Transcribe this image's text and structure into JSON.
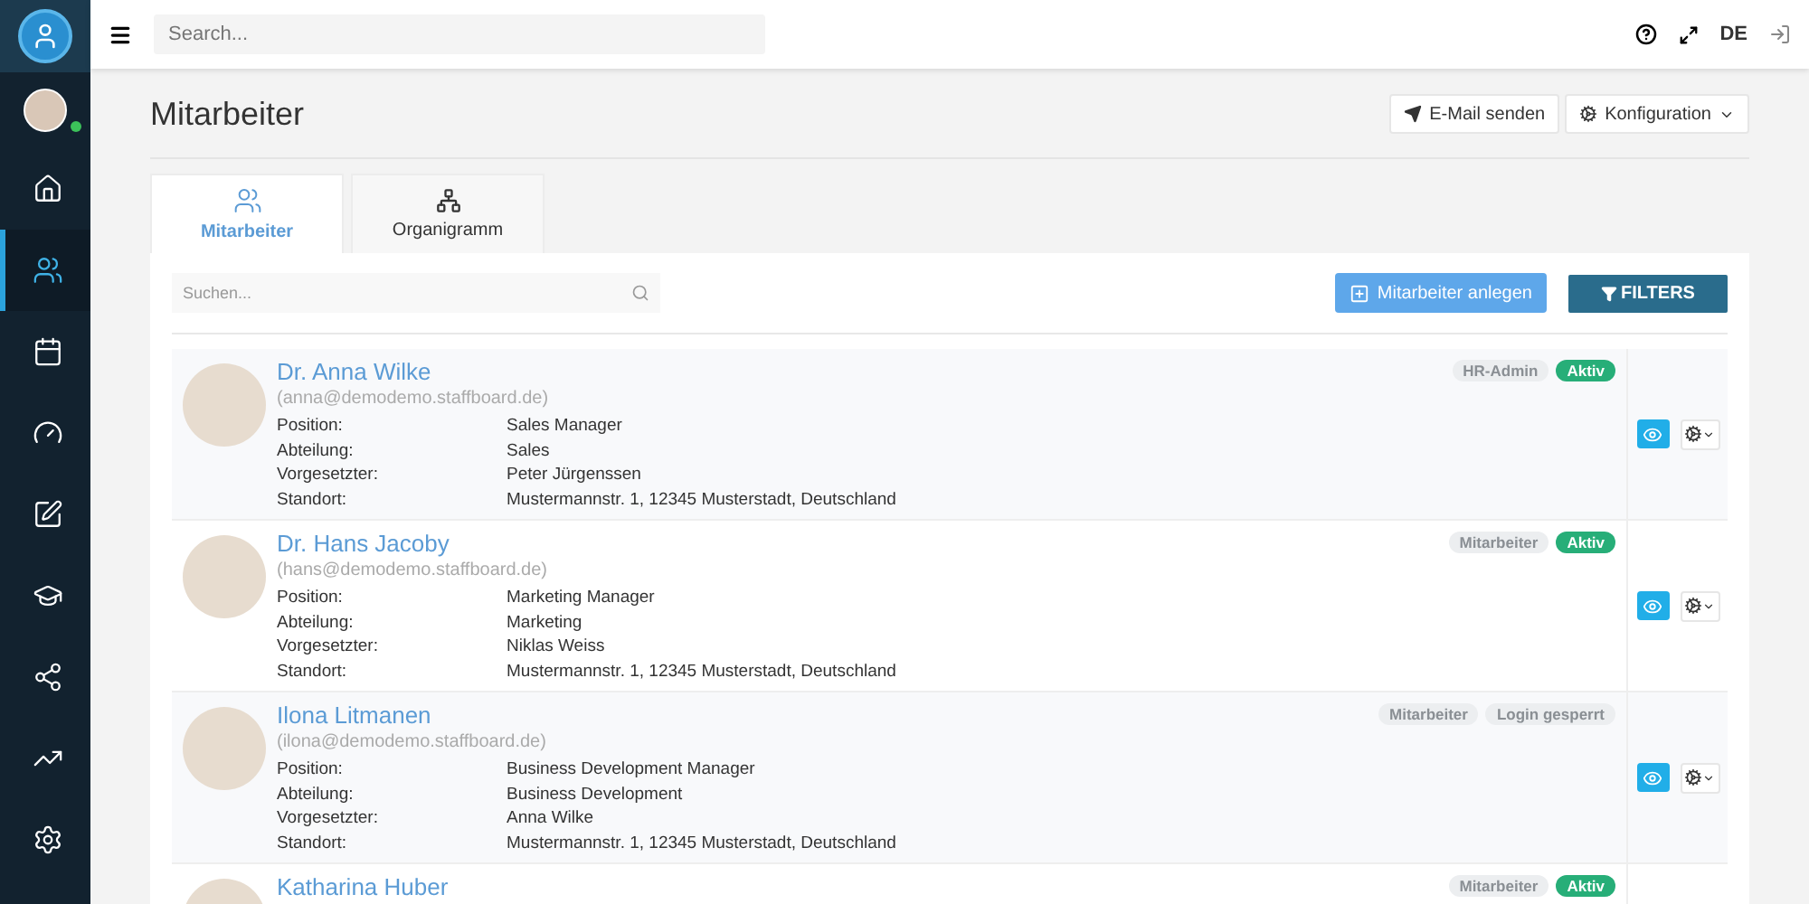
{
  "topbar": {
    "search_placeholder": "Search...",
    "language": "DE"
  },
  "sidebar": {
    "items": [
      {
        "kind": "home",
        "selected": false
      },
      {
        "kind": "users",
        "selected": true
      },
      {
        "kind": "calendar",
        "selected": false
      },
      {
        "kind": "gauge",
        "selected": false
      },
      {
        "kind": "edit",
        "selected": false
      },
      {
        "kind": "education",
        "selected": false
      },
      {
        "kind": "share",
        "selected": false
      },
      {
        "kind": "trend",
        "selected": false
      },
      {
        "kind": "settings",
        "selected": false
      }
    ]
  },
  "page": {
    "title": "Mitarbeiter",
    "actions": [
      {
        "kind": "email",
        "label": "E-Mail senden"
      },
      {
        "kind": "config",
        "label": "Konfiguration"
      }
    ]
  },
  "tabs": [
    {
      "kind": "users",
      "label": "Mitarbeiter",
      "selected": true
    },
    {
      "kind": "org",
      "label": "Organigramm",
      "selected": false
    }
  ],
  "toolbar": {
    "search_placeholder": "Suchen...",
    "add_button": "Mitarbeiter anlegen",
    "filter_button": "FILTERS"
  },
  "employees": [
    {
      "name": "Dr. Anna Wilke",
      "email": "(anna@demodemo.staffboard.de)",
      "badges": [
        {
          "kind": "role",
          "label": "HR-Admin"
        },
        {
          "kind": "active",
          "label": "Aktiv"
        }
      ],
      "fields": [
        {
          "label": "Position:",
          "value": "Sales Manager"
        },
        {
          "label": "Abteilung:",
          "value": "Sales"
        },
        {
          "label": "Vorgesetzter:",
          "value": "Peter Jürgenssen"
        },
        {
          "label": "Standort:",
          "value": "Mustermannstr. 1, 12345 Musterstadt, Deutschland"
        }
      ]
    },
    {
      "name": "Dr. Hans Jacoby",
      "email": "(hans@demodemo.staffboard.de)",
      "badges": [
        {
          "kind": "role",
          "label": "Mitarbeiter"
        },
        {
          "kind": "active",
          "label": "Aktiv"
        }
      ],
      "fields": [
        {
          "label": "Position:",
          "value": "Marketing Manager"
        },
        {
          "label": "Abteilung:",
          "value": "Marketing"
        },
        {
          "label": "Vorgesetzter:",
          "value": "Niklas Weiss"
        },
        {
          "label": "Standort:",
          "value": "Mustermannstr. 1, 12345 Musterstadt, Deutschland"
        }
      ]
    },
    {
      "name": "Ilona Litmanen",
      "email": "(ilona@demodemo.staffboard.de)",
      "badges": [
        {
          "kind": "role",
          "label": "Mitarbeiter"
        },
        {
          "kind": "role",
          "label": "Login gesperrt"
        }
      ],
      "fields": [
        {
          "label": "Position:",
          "value": "Business Development Manager"
        },
        {
          "label": "Abteilung:",
          "value": "Business Development"
        },
        {
          "label": "Vorgesetzter:",
          "value": "Anna Wilke"
        },
        {
          "label": "Standort:",
          "value": "Mustermannstr. 1, 12345 Musterstadt, Deutschland"
        }
      ]
    },
    {
      "name": "Katharina Huber",
      "badges": [
        {
          "kind": "role",
          "label": "Mitarbeiter"
        },
        {
          "kind": "active",
          "label": "Aktiv"
        }
      ]
    }
  ]
}
